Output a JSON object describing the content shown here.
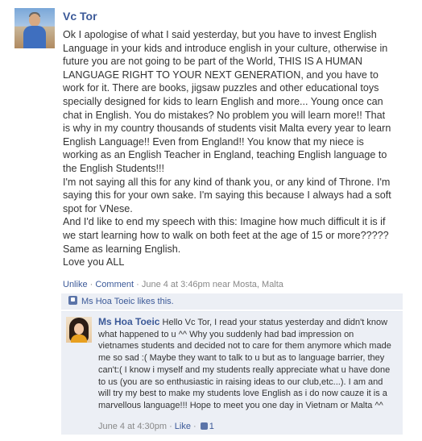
{
  "post": {
    "author": "Vc Tor",
    "paragraphs": [
      "Ok I apologise of what I said yesterday, but you have to invest English Language in your kids and introduce english in your culture, otherwise in future you are not going to be part of the World, THIS IS A HUMAN LANGUAGE RIGHT TO YOUR NEXT GENERATION, and you have to work for it. There are books, jigsaw puzzles and other educational toys specially designed for kids to learn English and more... Young once can chat in English. You do mistakes? No problem you will learn more!! That is why in my country thousands of students visit Malta every year to learn English Language!! Even from England!! You know that my niece is working as an English Teacher in England, teaching English language to the English Students!!!",
      "I'm not saying all this for any kind of thank you, or any kind of Throne. I'm saying this for your own sake. I'm saying this because I always had a soft spot for VNese.",
      "And I'd like to end my speech with this: Imagine how much difficult it is if we start learning how to walk on both feet at the age of 15 or more????? Same as learning English.",
      "Love you ALL"
    ],
    "meta": {
      "unlike": "Unlike",
      "sep": " · ",
      "comment": "Comment",
      "time_prefix": "June 4 at 3:46pm near Mosta, Malta"
    }
  },
  "likes": {
    "text": "Ms Hoa Toeic likes this."
  },
  "comment": {
    "author": "Ms Hoa Toeic",
    "text": "Hello Vc Tor, I read your status yesterday and didn't know what happened to u ^^ Why you suddenly had bad impression on vietnames students and decided not to care for them anymore which made me so sad :( Maybe they want to talk to u but as to language barrier, they can't:( I know i myself and my students really appreciate what u have done to us (you are so enthusiastic in raising ideas to our club,etc...). I am and will try my best to make my students love English as i do now cauze it is a marvellous language!!! Hope to meet you one day in Vietnam or Malta ^^",
    "time": "June 4 at 4:30pm",
    "like": "Like",
    "like_count": "1"
  }
}
